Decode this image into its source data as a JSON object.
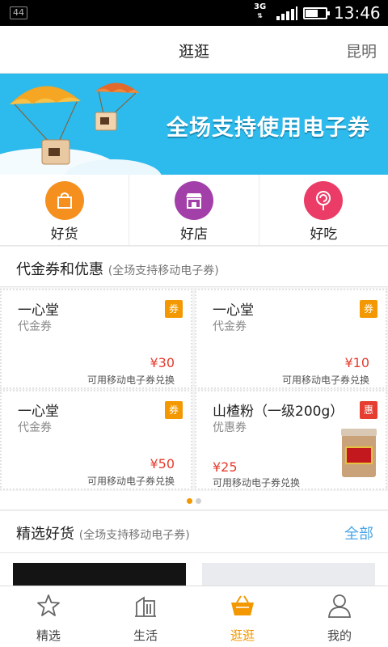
{
  "status_bar": {
    "notification": "44",
    "network": "3G",
    "time": "13:46"
  },
  "header": {
    "title": "逛逛",
    "city": "昆明"
  },
  "banner": {
    "text": "全场支持使用电子券"
  },
  "categories": [
    {
      "label": "好货",
      "icon": "shopping-bag-icon",
      "color": "#f5901e"
    },
    {
      "label": "好店",
      "icon": "storefront-icon",
      "color": "#a23fa8"
    },
    {
      "label": "好吃",
      "icon": "lollipop-icon",
      "color": "#ea3c66"
    }
  ],
  "coupon_section": {
    "title": "代金券和优惠",
    "subtitle": "(全场支持移动电子券)"
  },
  "coupons": [
    {
      "name": "一心堂",
      "kind": "代金券",
      "badge": "券",
      "badge_color": "#f39800",
      "price": "¥30",
      "note": "可用移动电子券兑换"
    },
    {
      "name": "一心堂",
      "kind": "代金券",
      "badge": "券",
      "badge_color": "#f39800",
      "price": "¥10",
      "note": "可用移动电子券兑换"
    },
    {
      "name": "一心堂",
      "kind": "代金券",
      "badge": "券",
      "badge_color": "#f39800",
      "price": "¥50",
      "note": "可用移动电子券兑换"
    },
    {
      "name": "山楂粉（一级200g）",
      "kind": "优惠券",
      "badge": "惠",
      "badge_color": "#e53d2f",
      "price": "¥25",
      "note": "可用移动电子券兑换"
    }
  ],
  "carousel": {
    "active": 1,
    "total": 2,
    "active_color": "#f39800"
  },
  "goods_section": {
    "title": "精选好货",
    "subtitle": "(全场支持移动电子券)",
    "more": "全部"
  },
  "tabs": [
    {
      "label": "精选",
      "icon": "star-icon"
    },
    {
      "label": "生活",
      "icon": "building-icon"
    },
    {
      "label": "逛逛",
      "icon": "basket-icon",
      "active": true
    },
    {
      "label": "我的",
      "icon": "person-icon"
    }
  ]
}
